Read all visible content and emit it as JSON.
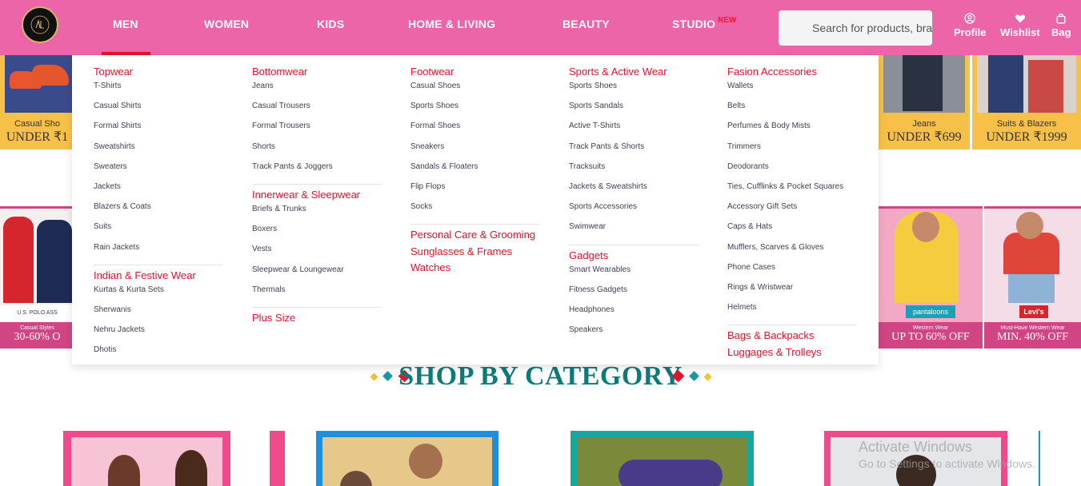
{
  "header": {
    "nav": [
      "MEN",
      "WOMEN",
      "KIDS",
      "HOME & LIVING",
      "BEAUTY",
      "STUDIO"
    ],
    "new_badge": "NEW",
    "search_placeholder": "Search for products, brands and more",
    "actions": [
      "Profile",
      "Wishlist",
      "Bag"
    ],
    "accent": "#ec65a8"
  },
  "menu": {
    "columns": [
      {
        "groups": [
          {
            "title": "Topwear",
            "items": [
              "T-Shirts",
              "Casual Shirts",
              "Formal Shirts",
              "Sweatshirts",
              "Sweaters",
              "Jackets",
              "Blazers & Coats",
              "Suits",
              "Rain Jackets"
            ]
          },
          {
            "title": "Indian & Festive Wear",
            "items": [
              "Kurtas & Kurta Sets",
              "Sherwanis",
              "Nehru Jackets",
              "Dhotis"
            ]
          }
        ]
      },
      {
        "groups": [
          {
            "title": "Bottomwear",
            "items": [
              "Jeans",
              "Casual Trousers",
              "Formal Trousers",
              "Shorts",
              "Track Pants & Joggers"
            ]
          },
          {
            "title": "Innerwear & Sleepwear",
            "items": [
              "Briefs & Trunks",
              "Boxers",
              "Vests",
              "Sleepwear & Loungewear",
              "Thermals"
            ]
          },
          {
            "title": "Plus Size",
            "items": []
          }
        ]
      },
      {
        "groups": [
          {
            "title": "Footwear",
            "items": [
              "Casual Shoes",
              "Sports Shoes",
              "Formal Shoes",
              "Sneakers",
              "Sandals & Floaters",
              "Flip Flops",
              "Socks"
            ]
          },
          {
            "title": "Personal Care & Grooming",
            "items": [],
            "extra": [
              "Sunglasses & Frames",
              "Watches"
            ]
          }
        ]
      },
      {
        "groups": [
          {
            "title": "Sports & Active Wear",
            "items": [
              "Sports Shoes",
              "Sports Sandals",
              "Active T-Shirts",
              "Track Pants & Shorts",
              "Tracksuits",
              "Jackets & Sweatshirts",
              "Sports Accessories",
              "Swimwear"
            ]
          },
          {
            "title": "Gadgets",
            "items": [
              "Smart Wearables",
              "Fitness Gadgets",
              "Headphones",
              "Speakers"
            ]
          }
        ]
      },
      {
        "groups": [
          {
            "title": "Fasion Accessories",
            "items": [
              "Wallets",
              "Belts",
              "Perfumes & Body Mists",
              "Trimmers",
              "Deodorants",
              "Ties, Cufflinks & Pocket Squares",
              "Accessory Gift Sets",
              "Caps & Hats",
              "Mufflers, Scarves & Gloves",
              "Phone Cases",
              "Rings & Wristwear",
              "Helmets"
            ]
          },
          {
            "title": "Bags & Backpacks",
            "items": [],
            "extra": [
              "Luggages & Trolleys"
            ]
          }
        ]
      }
    ]
  },
  "banners": {
    "top_left": {
      "label": "Casual Sho",
      "price": "UNDER ₹1"
    },
    "top_right_1": {
      "label": "Jeans",
      "price": "UNDER ₹699"
    },
    "top_right_2": {
      "label": "Suits & Blazers",
      "price": "UNDER ₹1999"
    },
    "mid_left": {
      "brand": "U.S. POLO ASS",
      "label": "Casual Styles",
      "price": "30-60% O"
    },
    "mid_right_1": {
      "brand": "pantaloons",
      "label": "Western Wear",
      "price": "UP TO 60% OFF"
    },
    "mid_right_2": {
      "brand": "Levi's",
      "label": "Must-Have Western Wear",
      "price": "MIN. 40% OFF"
    }
  },
  "section_title": "SHOP BY CATEGORY",
  "watermark": {
    "line1": "Activate Windows",
    "line2": "Go to Settings to activate Windows."
  }
}
